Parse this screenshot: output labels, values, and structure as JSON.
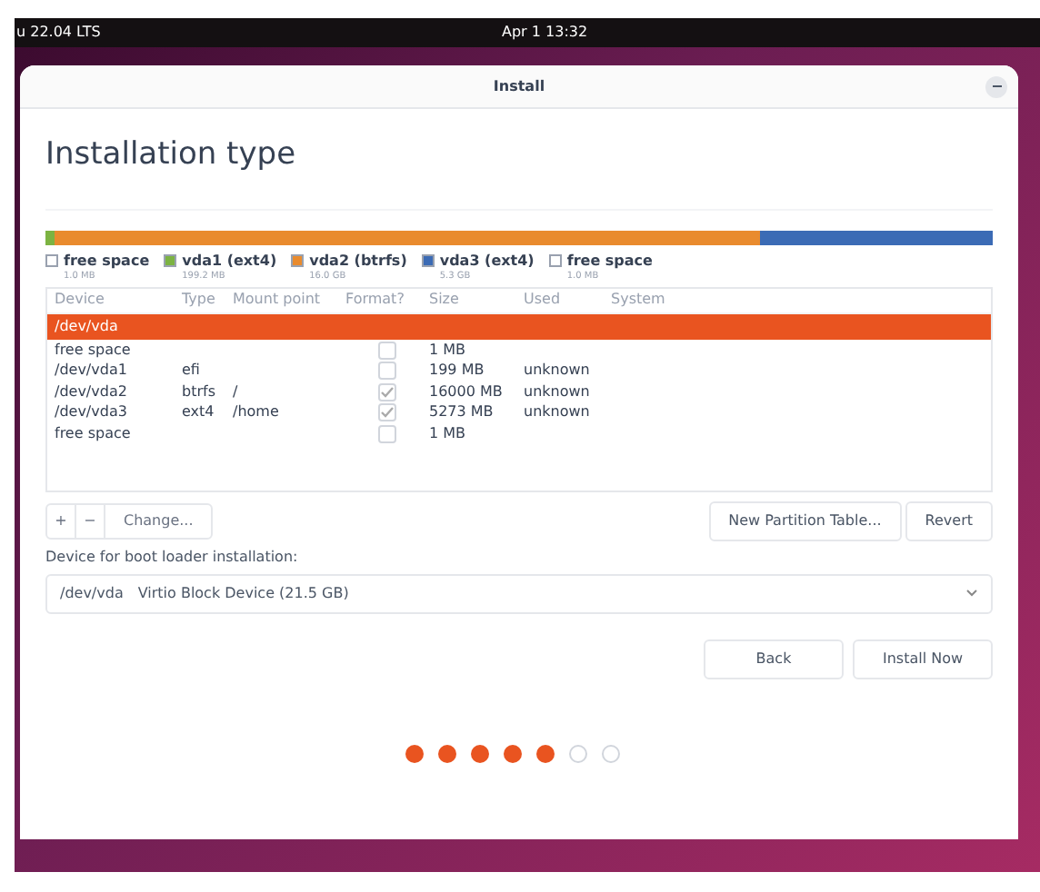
{
  "top_bar": {
    "left": "u 22.04 LTS",
    "clock": "Apr 1  13:32"
  },
  "window": {
    "title": "Install"
  },
  "heading": "Installation type",
  "partitions": [
    {
      "kind": "free",
      "name": "free space",
      "size": "1.0 MB",
      "color": "#ffffff"
    },
    {
      "kind": "partition",
      "name": "vda1 (ext4)",
      "size": "199.2 MB",
      "color": "#7cb342"
    },
    {
      "kind": "partition",
      "name": "vda2 (btrfs)",
      "size": "16.0 GB",
      "color": "#e98b2e"
    },
    {
      "kind": "partition",
      "name": "vda3 (ext4)",
      "size": "5.3 GB",
      "color": "#3b6bb5"
    },
    {
      "kind": "free",
      "name": "free space",
      "size": "1.0 MB",
      "color": "#ffffff"
    }
  ],
  "table": {
    "columns": [
      "Device",
      "Type",
      "Mount point",
      "Format?",
      "Size",
      "Used",
      "System"
    ],
    "rows": [
      {
        "kind": "disk",
        "device": "/dev/vda",
        "selected": true
      },
      {
        "kind": "partition",
        "device": "free space",
        "type": "",
        "mount": "",
        "format": false,
        "size": "1 MB",
        "used": "",
        "selected": false
      },
      {
        "kind": "partition",
        "device": "/dev/vda1",
        "type": "efi",
        "mount": "",
        "format": false,
        "size": "199 MB",
        "used": "unknown",
        "selected": false
      },
      {
        "kind": "partition",
        "device": "/dev/vda2",
        "type": "btrfs",
        "mount": "/",
        "format": true,
        "size": "16000 MB",
        "used": "unknown",
        "selected": false
      },
      {
        "kind": "partition",
        "device": "/dev/vda3",
        "type": "ext4",
        "mount": "/home",
        "format": true,
        "size": "5273 MB",
        "used": "unknown",
        "selected": false
      },
      {
        "kind": "partition",
        "device": "free space",
        "type": "",
        "mount": "",
        "format": false,
        "size": "1 MB",
        "used": "",
        "selected": false
      }
    ]
  },
  "toolbar": {
    "add": "+",
    "remove": "−",
    "change": "Change...",
    "new_table": "New Partition Table...",
    "revert": "Revert"
  },
  "boot_loader": {
    "label": "Device for boot loader installation:",
    "device": "/dev/vda",
    "description": "Virtio Block Device (21.5 GB)"
  },
  "buttons": {
    "back": "Back",
    "install": "Install Now"
  },
  "progress_dots": [
    {
      "done": true
    },
    {
      "done": true
    },
    {
      "done": true
    },
    {
      "done": true
    },
    {
      "done": true
    },
    {
      "done": false
    },
    {
      "done": false
    }
  ]
}
